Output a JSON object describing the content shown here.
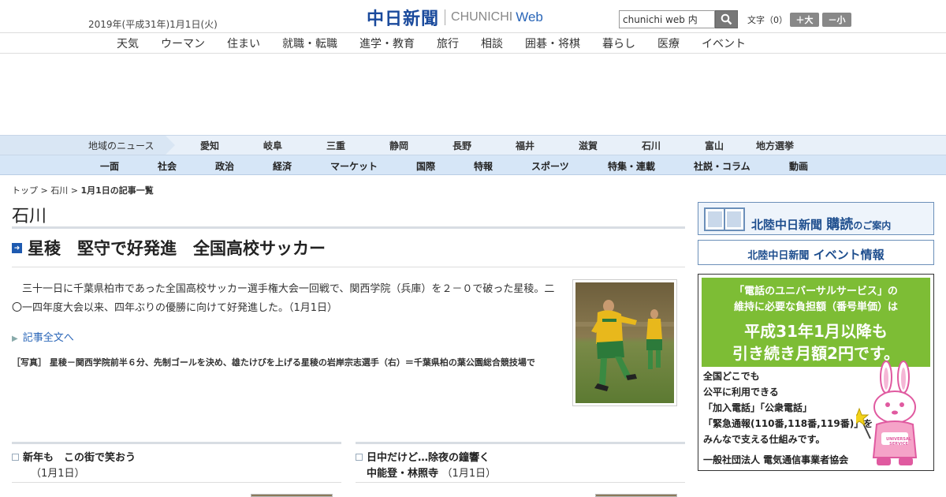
{
  "header": {
    "date": "2019年(平成31年)1月1日(火)",
    "logo_kanji": "中日新聞",
    "logo_en": "CHUNICHI",
    "logo_web": "Web",
    "search_value": "chunichi web 内",
    "font_size_label": "文字（0）",
    "font_larger": "＋大",
    "font_smaller": "－小"
  },
  "top_nav": [
    "天気",
    "ウーマン",
    "住まい",
    "就職・転職",
    "進学・教育",
    "旅行",
    "相談",
    "囲碁・将棋",
    "暮らし",
    "医療",
    "イベント"
  ],
  "region_nav": {
    "label": "地域のニュース",
    "items": [
      "愛知",
      "岐阜",
      "三重",
      "静岡",
      "長野",
      "福井",
      "滋賀",
      "石川",
      "富山",
      "地方選挙"
    ]
  },
  "category_nav": [
    "一面",
    "社会",
    "政治",
    "経済",
    "マーケット",
    "国際",
    "特報",
    "スポーツ",
    "特集・連載",
    "社説・コラム",
    "動画"
  ],
  "breadcrumb": {
    "top": "トップ",
    "sep": " > ",
    "region": "石川",
    "current": "1月1日の記事一覧"
  },
  "page_title": "石川",
  "article": {
    "headline": "星稜　堅守で好発進　全国高校サッカー",
    "body": "三十一日に千葉県柏市であった全国高校サッカー選手権大会一回戦で、関西学院（兵庫）を２－０で破った星稜。二〇一四年度大会以来、四年ぶりの優勝に向けて好発進した。（1月1日）",
    "read_more": "記事全文へ",
    "caption": "［写真］ 星稜－関西学院前半６分、先制ゴールを決め、雄たけびを上げる星稜の岩岸宗志選手（右）＝千葉県柏の葉公園総合競技場で"
  },
  "sub_articles": [
    {
      "title": "新年も　この街で笑おう",
      "date": "（1月1日）"
    },
    {
      "title": "日中だけど…除夜の鐘響く",
      "title2": "中能登・林照寺",
      "date": "（1月1日）"
    }
  ],
  "sidebar": {
    "subscribe_title": "北陸中日新聞",
    "subscribe_main": "購読",
    "subscribe_rest": "のご案内",
    "event_title": "北陸中日新聞",
    "event_main": "イベント情報",
    "ad": {
      "line1": "「電話のユニバーサルサービス」の",
      "line2": "維持に必要な負担額（番号単価）は",
      "line3": "平成31年1月以降も",
      "line4": "引き続き月額2円です。",
      "l5": "全国どこでも",
      "l6": "公平に利用できる",
      "l7": "「加入電話」「公衆電話」",
      "l8": "「緊急通報(110番,118番,119番)」を",
      "l9": "みんなで支える仕組みです。",
      "l10": "一般社団法人 電気通信事業者協会",
      "mascot": "UNIVERSAL SERVICE"
    }
  }
}
